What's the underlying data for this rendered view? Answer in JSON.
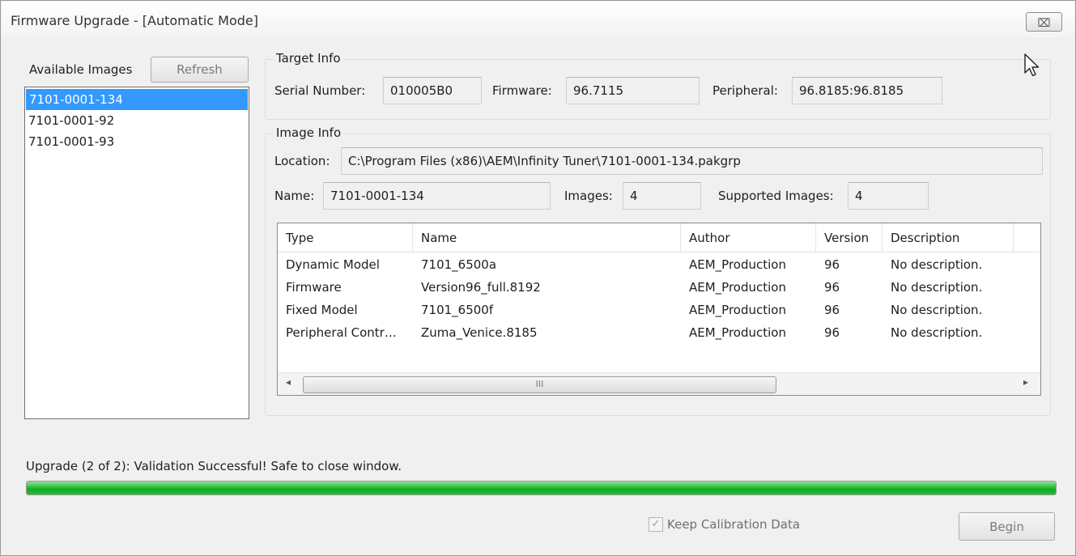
{
  "window": {
    "title": "Firmware Upgrade - [Automatic Mode]",
    "close_glyph": "⌧"
  },
  "images_panel": {
    "label": "Available Images",
    "refresh_label": "Refresh",
    "items": [
      {
        "label": "7101-0001-134",
        "selected": true
      },
      {
        "label": "7101-0001-92",
        "selected": false
      },
      {
        "label": "7101-0001-93",
        "selected": false
      }
    ]
  },
  "target_info": {
    "title": "Target Info",
    "serial_label": "Serial Number:",
    "serial_value": "010005B0",
    "firmware_label": "Firmware:",
    "firmware_value": "96.7115",
    "peripheral_label": "Peripheral:",
    "peripheral_value": "96.8185:96.8185"
  },
  "image_info": {
    "title": "Image Info",
    "location_label": "Location:",
    "location_value": "C:\\Program Files (x86)\\AEM\\Infinity Tuner\\7101-0001-134.pakgrp",
    "name_label": "Name:",
    "name_value": "7101-0001-134",
    "images_label": "Images:",
    "images_value": "4",
    "supported_label": "Supported Images:",
    "supported_value": "4"
  },
  "table": {
    "columns": [
      "Type",
      "Name",
      "Author",
      "Version",
      "Description"
    ],
    "rows": [
      [
        "Dynamic Model",
        "7101_6500a",
        "AEM_Production",
        "96",
        "No description."
      ],
      [
        "Firmware",
        "Version96_full.8192",
        "AEM_Production",
        "96",
        "No description."
      ],
      [
        "Fixed Model",
        "7101_6500f",
        "AEM_Production",
        "96",
        "No description."
      ],
      [
        "Peripheral Contr…",
        "Zuma_Venice.8185",
        "AEM_Production",
        "96",
        "No description."
      ]
    ],
    "scroll_left": "◂",
    "scroll_right": "▸",
    "scroll_thumb_grip": "III"
  },
  "status": {
    "text": "Upgrade (2 of 2): Validation Successful!  Safe to close window.",
    "progress_percent": 100,
    "progress_color": "#1fb52f"
  },
  "footer": {
    "keep_calibration_label": "Keep Calibration Data",
    "keep_calibration_checked": true,
    "checkmark_glyph": "✓",
    "begin_label": "Begin"
  }
}
